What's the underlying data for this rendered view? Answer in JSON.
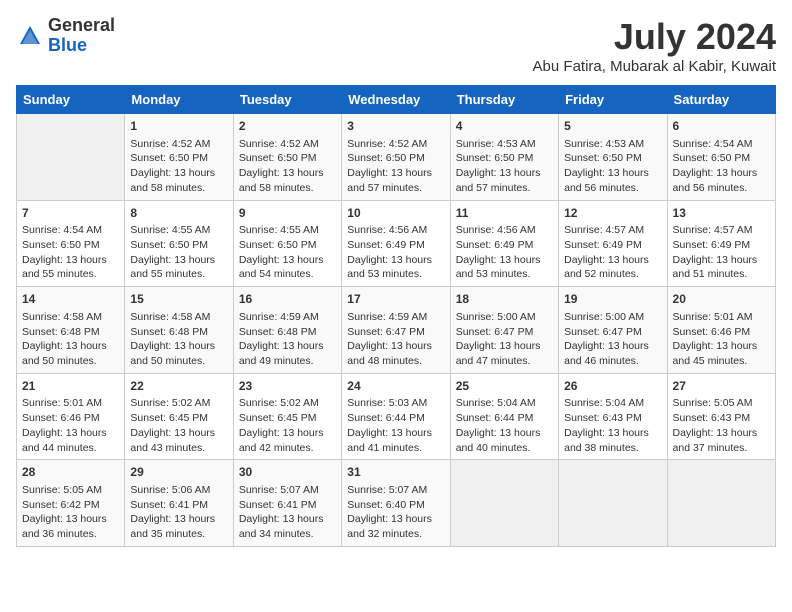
{
  "header": {
    "logo_general": "General",
    "logo_blue": "Blue",
    "month_year": "July 2024",
    "location": "Abu Fatira, Mubarak al Kabir, Kuwait"
  },
  "days_of_week": [
    "Sunday",
    "Monday",
    "Tuesday",
    "Wednesday",
    "Thursday",
    "Friday",
    "Saturday"
  ],
  "weeks": [
    [
      {
        "day": "",
        "empty": true
      },
      {
        "day": "1",
        "sunrise": "4:52 AM",
        "sunset": "6:50 PM",
        "daylight": "13 hours and 58 minutes."
      },
      {
        "day": "2",
        "sunrise": "4:52 AM",
        "sunset": "6:50 PM",
        "daylight": "13 hours and 58 minutes."
      },
      {
        "day": "3",
        "sunrise": "4:52 AM",
        "sunset": "6:50 PM",
        "daylight": "13 hours and 57 minutes."
      },
      {
        "day": "4",
        "sunrise": "4:53 AM",
        "sunset": "6:50 PM",
        "daylight": "13 hours and 57 minutes."
      },
      {
        "day": "5",
        "sunrise": "4:53 AM",
        "sunset": "6:50 PM",
        "daylight": "13 hours and 56 minutes."
      },
      {
        "day": "6",
        "sunrise": "4:54 AM",
        "sunset": "6:50 PM",
        "daylight": "13 hours and 56 minutes."
      }
    ],
    [
      {
        "day": "7",
        "sunrise": "4:54 AM",
        "sunset": "6:50 PM",
        "daylight": "13 hours and 55 minutes."
      },
      {
        "day": "8",
        "sunrise": "4:55 AM",
        "sunset": "6:50 PM",
        "daylight": "13 hours and 55 minutes."
      },
      {
        "day": "9",
        "sunrise": "4:55 AM",
        "sunset": "6:50 PM",
        "daylight": "13 hours and 54 minutes."
      },
      {
        "day": "10",
        "sunrise": "4:56 AM",
        "sunset": "6:49 PM",
        "daylight": "13 hours and 53 minutes."
      },
      {
        "day": "11",
        "sunrise": "4:56 AM",
        "sunset": "6:49 PM",
        "daylight": "13 hours and 53 minutes."
      },
      {
        "day": "12",
        "sunrise": "4:57 AM",
        "sunset": "6:49 PM",
        "daylight": "13 hours and 52 minutes."
      },
      {
        "day": "13",
        "sunrise": "4:57 AM",
        "sunset": "6:49 PM",
        "daylight": "13 hours and 51 minutes."
      }
    ],
    [
      {
        "day": "14",
        "sunrise": "4:58 AM",
        "sunset": "6:48 PM",
        "daylight": "13 hours and 50 minutes."
      },
      {
        "day": "15",
        "sunrise": "4:58 AM",
        "sunset": "6:48 PM",
        "daylight": "13 hours and 50 minutes."
      },
      {
        "day": "16",
        "sunrise": "4:59 AM",
        "sunset": "6:48 PM",
        "daylight": "13 hours and 49 minutes."
      },
      {
        "day": "17",
        "sunrise": "4:59 AM",
        "sunset": "6:47 PM",
        "daylight": "13 hours and 48 minutes."
      },
      {
        "day": "18",
        "sunrise": "5:00 AM",
        "sunset": "6:47 PM",
        "daylight": "13 hours and 47 minutes."
      },
      {
        "day": "19",
        "sunrise": "5:00 AM",
        "sunset": "6:47 PM",
        "daylight": "13 hours and 46 minutes."
      },
      {
        "day": "20",
        "sunrise": "5:01 AM",
        "sunset": "6:46 PM",
        "daylight": "13 hours and 45 minutes."
      }
    ],
    [
      {
        "day": "21",
        "sunrise": "5:01 AM",
        "sunset": "6:46 PM",
        "daylight": "13 hours and 44 minutes."
      },
      {
        "day": "22",
        "sunrise": "5:02 AM",
        "sunset": "6:45 PM",
        "daylight": "13 hours and 43 minutes."
      },
      {
        "day": "23",
        "sunrise": "5:02 AM",
        "sunset": "6:45 PM",
        "daylight": "13 hours and 42 minutes."
      },
      {
        "day": "24",
        "sunrise": "5:03 AM",
        "sunset": "6:44 PM",
        "daylight": "13 hours and 41 minutes."
      },
      {
        "day": "25",
        "sunrise": "5:04 AM",
        "sunset": "6:44 PM",
        "daylight": "13 hours and 40 minutes."
      },
      {
        "day": "26",
        "sunrise": "5:04 AM",
        "sunset": "6:43 PM",
        "daylight": "13 hours and 38 minutes."
      },
      {
        "day": "27",
        "sunrise": "5:05 AM",
        "sunset": "6:43 PM",
        "daylight": "13 hours and 37 minutes."
      }
    ],
    [
      {
        "day": "28",
        "sunrise": "5:05 AM",
        "sunset": "6:42 PM",
        "daylight": "13 hours and 36 minutes."
      },
      {
        "day": "29",
        "sunrise": "5:06 AM",
        "sunset": "6:41 PM",
        "daylight": "13 hours and 35 minutes."
      },
      {
        "day": "30",
        "sunrise": "5:07 AM",
        "sunset": "6:41 PM",
        "daylight": "13 hours and 34 minutes."
      },
      {
        "day": "31",
        "sunrise": "5:07 AM",
        "sunset": "6:40 PM",
        "daylight": "13 hours and 32 minutes."
      },
      {
        "day": "",
        "empty": true
      },
      {
        "day": "",
        "empty": true
      },
      {
        "day": "",
        "empty": true
      }
    ]
  ]
}
